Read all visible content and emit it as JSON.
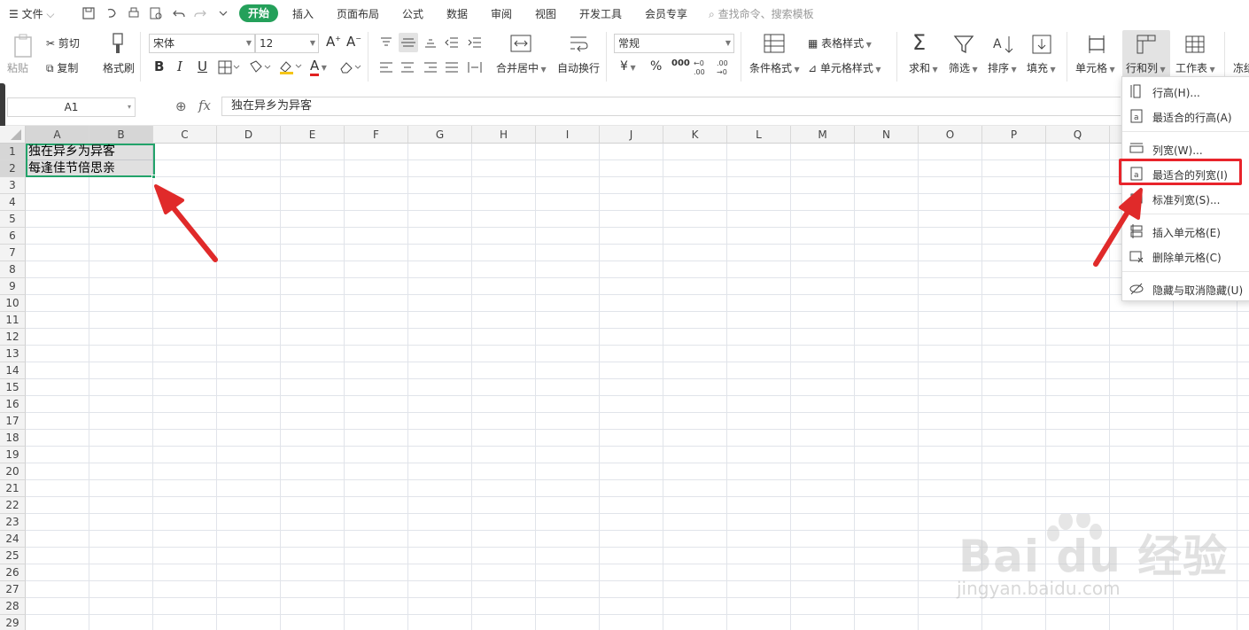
{
  "menubar": {
    "file_label": "文件",
    "start_label": "开始",
    "tabs": [
      "插入",
      "页面布局",
      "公式",
      "数据",
      "审阅",
      "视图",
      "开发工具",
      "会员专享"
    ],
    "search_placeholder": "查找命令、搜索模板"
  },
  "ribbon": {
    "paste_label": "粘贴",
    "cut_label": "剪切",
    "copy_label": "复制",
    "format_painter_label": "格式刷",
    "font_name": "宋体",
    "font_size": "12",
    "merge_center_label": "合并居中",
    "wrap_text_label": "自动换行",
    "number_format": "常规",
    "conditional_format_label": "条件格式",
    "table_style_label": "表格样式",
    "cell_style_label": "单元格样式",
    "sum_label": "求和",
    "filter_label": "筛选",
    "sort_label": "排序",
    "fill_label": "填充",
    "cell_label": "单元格",
    "row_col_label": "行和列",
    "worksheet_label": "工作表",
    "freeze_label": "冻结",
    "bold": "B",
    "italic": "I",
    "underline": "U",
    "currency": "¥",
    "percent": "%",
    "thousands": "000",
    "font_color_letter": "A"
  },
  "formula_bar": {
    "name_box": "A1",
    "fx_label": "fx",
    "content": "独在异乡为异客"
  },
  "sheet": {
    "columns": [
      "A",
      "B",
      "C",
      "D",
      "E",
      "F",
      "G",
      "H",
      "I",
      "J",
      "K",
      "L",
      "M",
      "N",
      "O",
      "P",
      "Q"
    ],
    "rows": [
      "1",
      "2",
      "3",
      "4",
      "5",
      "6",
      "7",
      "8",
      "9",
      "10",
      "11",
      "12",
      "13",
      "14",
      "15",
      "16",
      "17",
      "18",
      "19",
      "20",
      "21",
      "22",
      "23",
      "24",
      "25",
      "26",
      "27",
      "28",
      "29"
    ],
    "cells": {
      "A1": "独在异乡为异客",
      "A2": "每逢佳节倍思亲"
    }
  },
  "rowcol_menu": {
    "items": [
      {
        "label": "行高(H)...",
        "icon": "row-height-icon"
      },
      {
        "label": "最适合的行高(A)",
        "icon": "autofit-row-icon"
      },
      {
        "label": "列宽(W)...",
        "icon": "column-width-icon"
      },
      {
        "label": "最适合的列宽(I)",
        "icon": "autofit-column-icon"
      },
      {
        "label": "标准列宽(S)...",
        "icon": "standard-width-icon"
      },
      {
        "label": "插入单元格(E)",
        "icon": "insert-cell-icon"
      },
      {
        "label": "删除单元格(C)",
        "icon": "delete-cell-icon"
      },
      {
        "label": "隐藏与取消隐藏(U)",
        "icon": "hide-unhide-icon"
      }
    ]
  },
  "watermark": {
    "brand": "Bai du 经验",
    "url": "jingyan.baidu.com"
  },
  "colors": {
    "accent": "#24a05a",
    "selection_border": "#22a36a",
    "highlight_red": "#e8242b"
  }
}
